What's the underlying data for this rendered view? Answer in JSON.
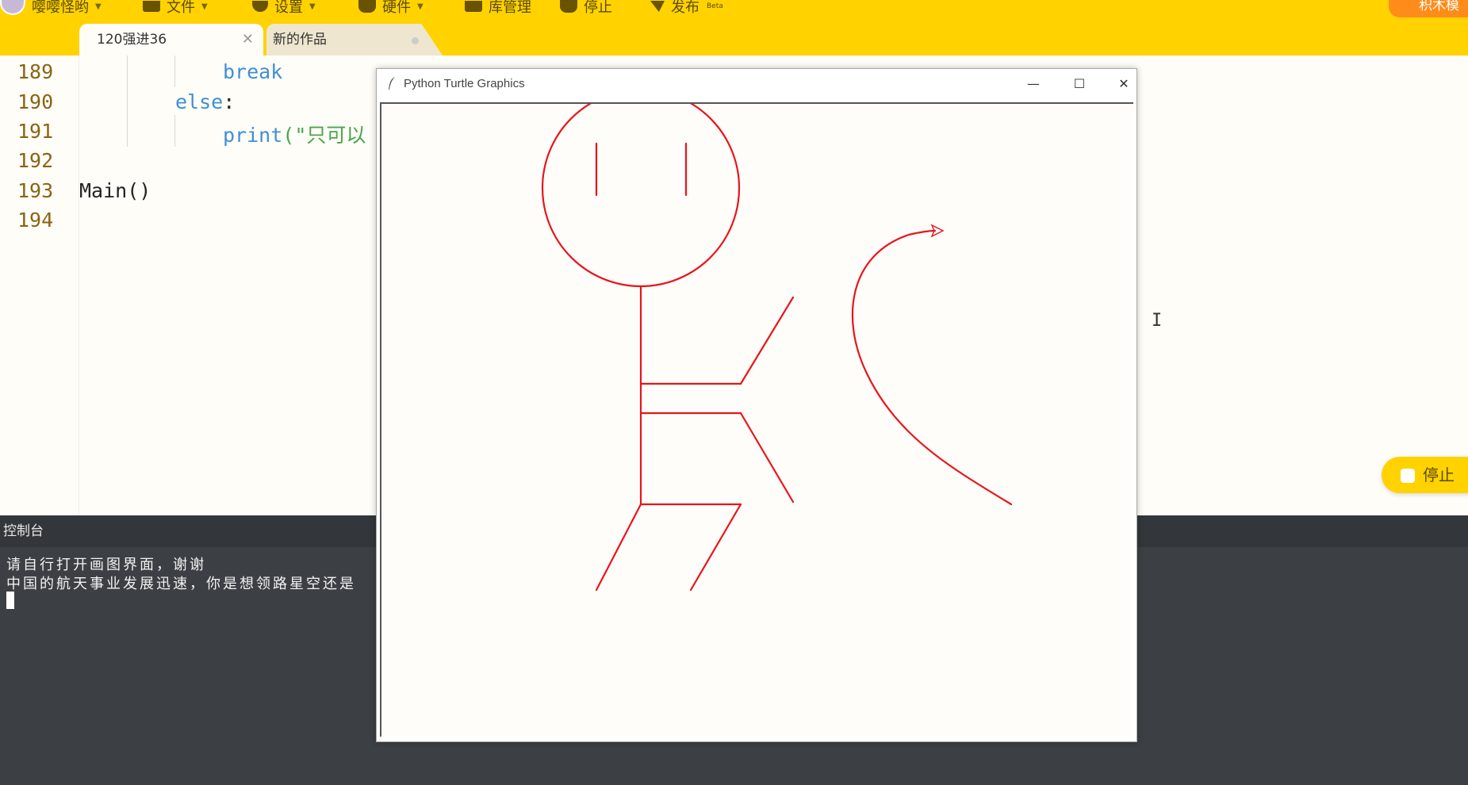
{
  "toolbar": {
    "user_label": "嘤嘤怪哟",
    "file_label": "文件",
    "settings_label": "设置",
    "hardware_label": "硬件",
    "library_label": "库管理",
    "stop_label": "停止",
    "publish_label": "发布",
    "publish_badge": "Beta",
    "right_pill_label": "积木模"
  },
  "tabs": [
    {
      "label": "120强进36"
    },
    {
      "label": "新的作品"
    }
  ],
  "editor": {
    "lines": [
      {
        "num": "189",
        "parts": [
          "break"
        ]
      },
      {
        "num": "190",
        "parts": [
          "else",
          ":"
        ]
      },
      {
        "num": "191",
        "parts": [
          "print",
          "(\"只可以"
        ]
      },
      {
        "num": "192",
        "parts": []
      },
      {
        "num": "193",
        "parts": [
          "Main()"
        ]
      },
      {
        "num": "194",
        "parts": []
      }
    ]
  },
  "console": {
    "title": "控制台",
    "lines": [
      "请自行打开画图界面，谢谢",
      "中国的航天事业发展迅速，你是想领路星空还是"
    ]
  },
  "turtle_window": {
    "title": "Python Turtle Graphics",
    "minimize": "—",
    "maximize": "☐",
    "close": "✕",
    "stroke_color": "#e8141c"
  },
  "floating": {
    "stop_label": "停止"
  }
}
